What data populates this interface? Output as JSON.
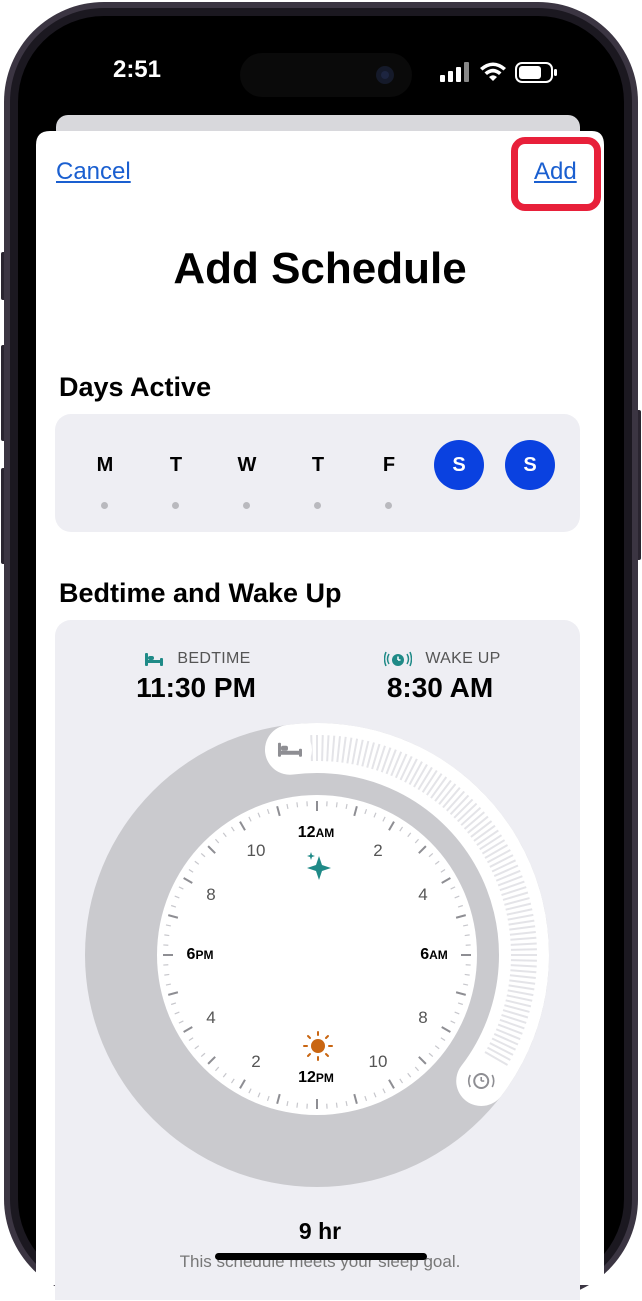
{
  "status_bar": {
    "time": "2:51",
    "icons": [
      "cellular-signal-icon",
      "wifi-icon",
      "battery-icon"
    ]
  },
  "nav": {
    "cancel_label": "Cancel",
    "add_label": "Add"
  },
  "page_title": "Add Schedule",
  "days_active": {
    "heading": "Days Active",
    "days": [
      {
        "letter": "M",
        "active": false
      },
      {
        "letter": "T",
        "active": false
      },
      {
        "letter": "W",
        "active": false
      },
      {
        "letter": "T",
        "active": false
      },
      {
        "letter": "F",
        "active": false
      },
      {
        "letter": "S",
        "active": true
      },
      {
        "letter": "S",
        "active": true
      }
    ]
  },
  "bedtime_wake": {
    "heading": "Bedtime and Wake Up",
    "bedtime_label": "BEDTIME",
    "bedtime_value": "11:30 PM",
    "wake_label": "WAKE UP",
    "wake_value": "8:30 AM",
    "clock": {
      "label_12am": "12AM",
      "label_2a": "2",
      "label_4a": "4",
      "label_6am": "6AM",
      "label_8a": "8",
      "label_10a": "10",
      "label_12pm": "12PM",
      "label_2p": "2",
      "label_4p": "4",
      "label_6pm": "6PM",
      "label_8p": "8",
      "label_10p": "10"
    },
    "duration": "9 hr",
    "goal_note": "This schedule meets your sleep goal."
  },
  "colors": {
    "accent_blue": "#0a41e0",
    "link_blue": "#1a5fd0",
    "highlight_red": "#e8203a",
    "teal": "#1f8a87",
    "sun_orange": "#c96612"
  }
}
